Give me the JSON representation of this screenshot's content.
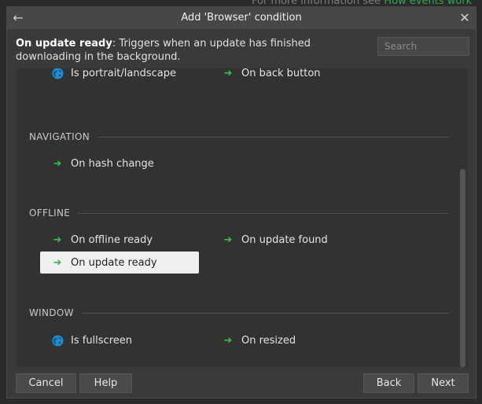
{
  "background": {
    "info_text": "For more information see ",
    "info_link": "How events work"
  },
  "dialog": {
    "title": "Add 'Browser' condition",
    "description_bold": "On update ready",
    "description_rest": ": Triggers when an update has finished downloading in the background.",
    "search_placeholder": "Search"
  },
  "list": {
    "top_items": [
      {
        "label": "Is portrait/landscape",
        "icon": "globe-icon"
      },
      {
        "label": "On back button",
        "icon": "trigger-arrow-icon"
      }
    ],
    "sections": [
      {
        "title": "NAVIGATION",
        "items": [
          {
            "label": "On hash change",
            "icon": "trigger-arrow-icon"
          }
        ]
      },
      {
        "title": "OFFLINE",
        "items": [
          {
            "label": "On offline ready",
            "icon": "trigger-arrow-icon"
          },
          {
            "label": "On update found",
            "icon": "trigger-arrow-icon"
          },
          {
            "label": "On update ready",
            "icon": "trigger-arrow-icon",
            "selected": true
          }
        ]
      },
      {
        "title": "WINDOW",
        "items": [
          {
            "label": "Is fullscreen",
            "icon": "globe-icon"
          },
          {
            "label": "On resized",
            "icon": "trigger-arrow-icon"
          }
        ]
      }
    ]
  },
  "buttons": {
    "cancel": "Cancel",
    "help": "Help",
    "back": "Back",
    "next": "Next"
  },
  "colors": {
    "accent_green": "#2fbf4a",
    "globe_blue": "#1e8fd6",
    "selected_bg": "#f0f0f0"
  }
}
